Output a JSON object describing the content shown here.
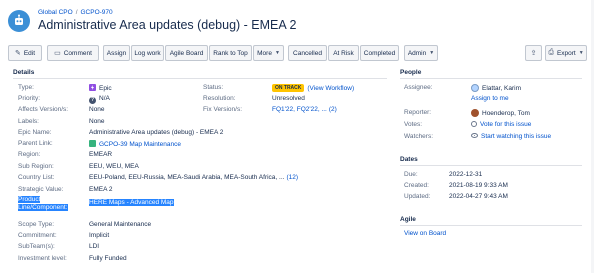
{
  "header": {
    "breadcrumb": [
      "Global CPO",
      "GCPO-970"
    ],
    "title": "Administrative Area updates (debug) - EMEA 2"
  },
  "toolbar": {
    "edit": "Edit",
    "comment": "Comment",
    "assign": "Assign",
    "log_work": "Log work",
    "agile_board": "Agile Board",
    "rank_to_top": "Rank to Top",
    "more": "More",
    "cancelled": "Cancelled",
    "at_risk": "At Risk",
    "completed": "Completed",
    "admin": "Admin",
    "export": "Export"
  },
  "details": {
    "title": "Details",
    "left": [
      {
        "label": "Type:",
        "value": "Epic",
        "icon": "epic-icon"
      },
      {
        "label": "Priority:",
        "value": "N/A",
        "icon": "priority-icon"
      },
      {
        "label": "Affects Version/s:",
        "value": "None"
      },
      {
        "label": "Labels:",
        "value": "None"
      },
      {
        "label": "Epic Name:",
        "value": "Administrative Area updates (debug) - EMEA 2"
      },
      {
        "label": "Parent Link:",
        "value": "GCPO-39 Map Maintenance",
        "icon": "story-icon"
      },
      {
        "label": "Region:",
        "value": "EMEAR"
      },
      {
        "label": "Sub Region:",
        "value": "EEU, WEU, MEA"
      },
      {
        "label": "Country List:",
        "value": "EEU-Poland, EEU-Russia, MEA-Saudi Arabia, MEA-South Africa, ...",
        "extra": "(12)"
      },
      {
        "label": "Strategic Value:",
        "value": "EMEA 2"
      },
      {
        "label": "Product",
        "label2": "Line/Component:",
        "value": "HERE Maps - Advanced Map"
      },
      {
        "label": "Scope Type:",
        "value": "General Maintenance"
      },
      {
        "label": "Commitment:",
        "value": "Implicit"
      },
      {
        "label": "SubTeam(s):",
        "value": "LDI"
      },
      {
        "label": "Investment level:",
        "value": "Fully Funded"
      }
    ],
    "right": [
      {
        "label": "Status:",
        "lozenge": "ON TRACK",
        "value": "(View Workflow)"
      },
      {
        "label": "Resolution:",
        "value": "Unresolved"
      },
      {
        "label": "Fix Version/s:",
        "value": "FQ1'22, FQ2'22, ...",
        "extra": "(2)"
      }
    ]
  },
  "people": {
    "title": "People",
    "assignee_label": "Assignee:",
    "assignee": "Elattar, Karim",
    "assign_to_me": "Assign to me",
    "reporter_label": "Reporter:",
    "reporter": "Hoenderop, Tom",
    "votes_label": "Votes:",
    "votes": "Vote for this issue",
    "watchers_label": "Watchers:",
    "watchers": "Start watching this issue"
  },
  "dates": {
    "title": "Dates",
    "due_label": "Due:",
    "due": "2022-12-31",
    "created_label": "Created:",
    "created": "2021-08-19 9:33 AM",
    "updated_label": "Updated:",
    "updated": "2022-04-27 9:43 AM"
  },
  "agile": {
    "title": "Agile",
    "view_on_board": "View on Board"
  },
  "colors": {
    "link": "#0052cc",
    "lozenge": "#ffc400",
    "highlight": "#2684ff",
    "epic": "#904ee2",
    "story": "#36b37e"
  }
}
